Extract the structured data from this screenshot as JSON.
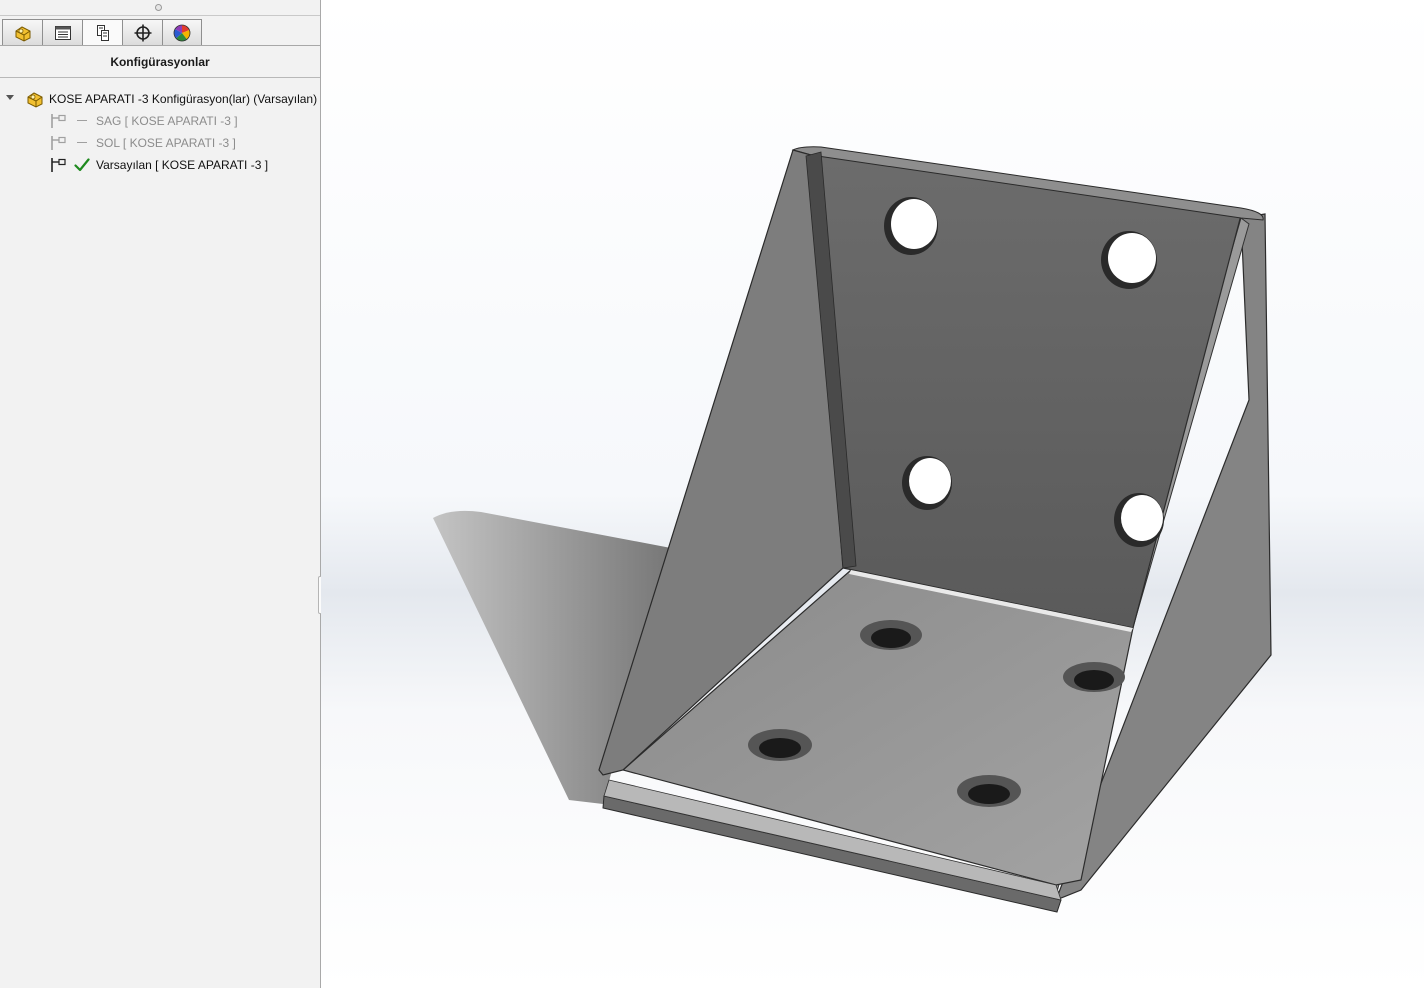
{
  "panel": {
    "title": "Konfigürasyonlar",
    "tabs": [
      {
        "name": "feature-manager",
        "icon": "part-icon"
      },
      {
        "name": "property-manager",
        "icon": "property-list-icon"
      },
      {
        "name": "configuration-manager",
        "icon": "configuration-icon",
        "active": true
      },
      {
        "name": "dimxpert-manager",
        "icon": "crosshair-icon"
      },
      {
        "name": "display-manager",
        "icon": "color-wheel-icon"
      }
    ]
  },
  "tree": {
    "root_label": "KOSE APARATI -3 Konfigürasyon(lar)  (Varsayılan)",
    "configs": [
      {
        "label": "SAG [ KOSE APARATI -3 ]",
        "state": "inactive"
      },
      {
        "label": "SOL [ KOSE APARATI -3 ]",
        "state": "inactive"
      },
      {
        "label": "Varsayılan [ KOSE APARATI -3 ]",
        "state": "active"
      }
    ]
  },
  "colors": {
    "active_check": "#1f8a1f",
    "part_gray": "#6e6e6e"
  }
}
